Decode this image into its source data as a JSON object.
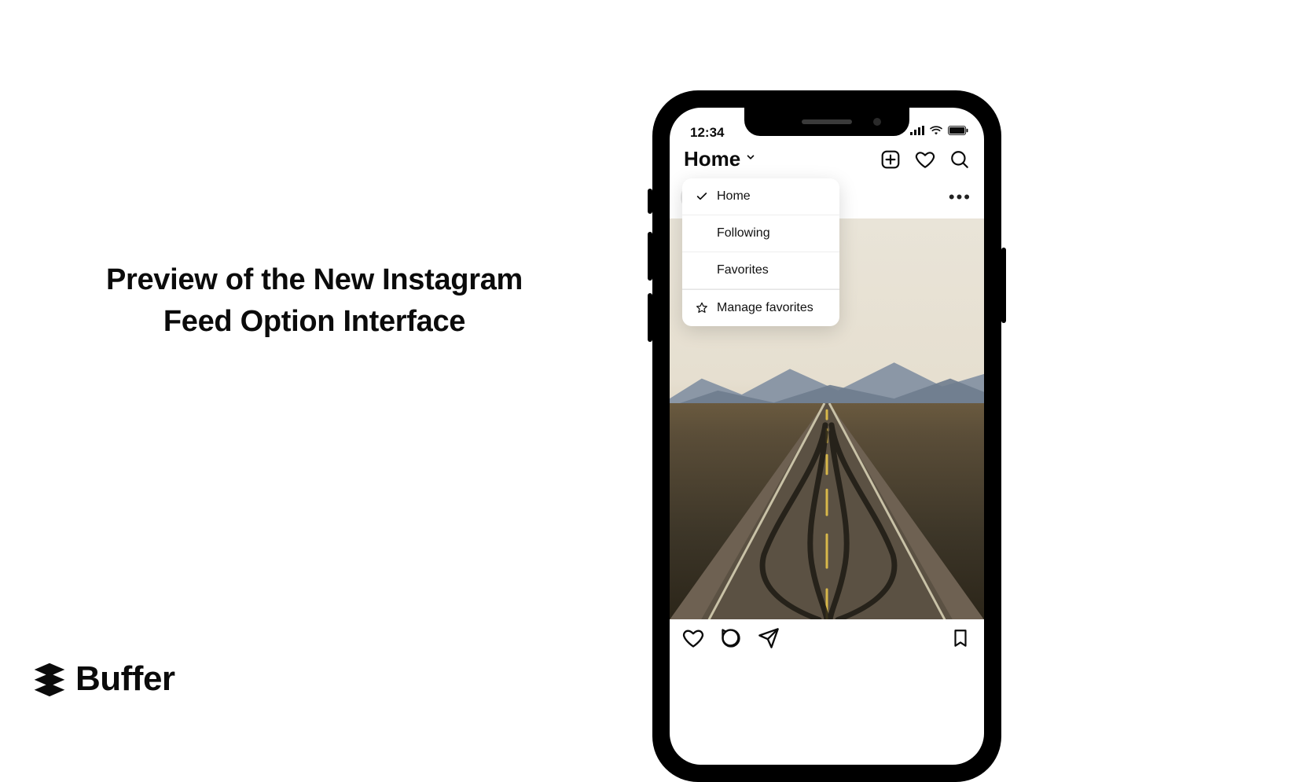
{
  "headline": "Preview of the New Instagram Feed Option Interface",
  "brand": "Buffer",
  "statusbar": {
    "time": "12:34"
  },
  "header": {
    "title": "Home"
  },
  "dropdown": {
    "items": [
      {
        "label": "Home",
        "checked": true
      },
      {
        "label": "Following",
        "checked": false
      },
      {
        "label": "Favorites",
        "checked": false
      }
    ],
    "manage": "Manage favorites"
  }
}
